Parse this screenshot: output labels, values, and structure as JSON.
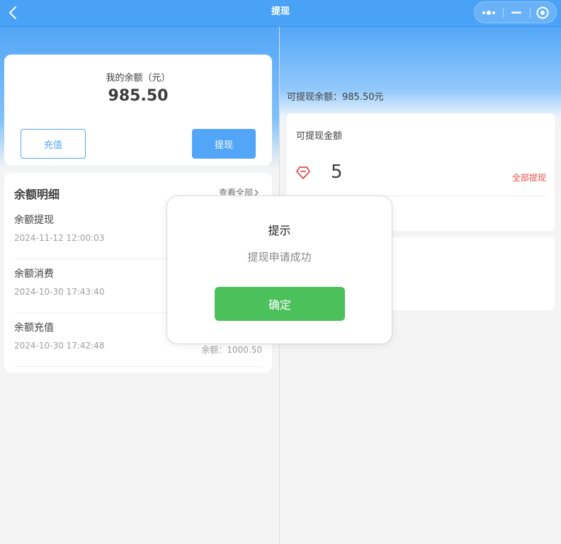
{
  "navbar": {
    "title": "提现",
    "back_icon": "chevron-left-icon",
    "capsule_icons": [
      "more-dots-icon",
      "minimize-icon",
      "close-circle-icon"
    ]
  },
  "balance": {
    "label": "我的余额（元）",
    "amount": "985.50",
    "recharge_label": "充值",
    "withdraw_label": "提现"
  },
  "details": {
    "title": "余额明细",
    "view_all": "查看全部",
    "items": [
      {
        "name": "余额提现",
        "time": "2024-11-12 12:00:03",
        "balance": ""
      },
      {
        "name": "余额消费",
        "time": "2024-10-30 17:43:40",
        "balance": ""
      },
      {
        "name": "余额充值",
        "time": "2024-10-30 17:42:48",
        "balance": "余额：1000.50"
      }
    ]
  },
  "withdraw": {
    "available_text": "可提现余额：985.50元",
    "amount_title": "可提现金额",
    "amount_value": "5",
    "withdraw_all": "全部提现"
  },
  "modal": {
    "title": "提示",
    "content": "提现申请成功",
    "confirm": "确定"
  },
  "colors": {
    "primary": "#4aa2f7",
    "confirm": "#4cc05a",
    "danger": "#e2453c"
  }
}
